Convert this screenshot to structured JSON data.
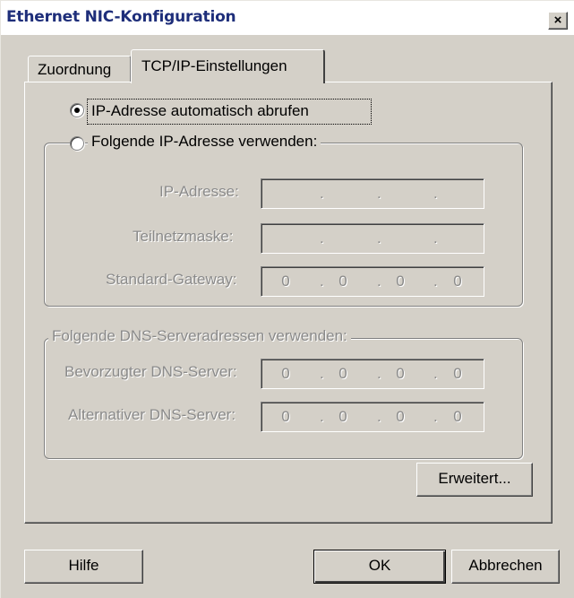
{
  "window": {
    "title": "Ethernet NIC-Konfiguration",
    "close_label": "×"
  },
  "tabs": [
    {
      "label": "Zuordnung"
    },
    {
      "label": "TCP/IP-Einstellungen"
    }
  ],
  "ip_mode": {
    "auto_label": "IP-Adresse automatisch abrufen",
    "manual_label": "Folgende IP-Adresse verwenden:",
    "selected": "auto"
  },
  "ip_group": {
    "fields": [
      {
        "label": "IP-Adresse:",
        "octets": [
          "",
          "",
          "",
          ""
        ]
      },
      {
        "label": "Teilnetzmaske:",
        "octets": [
          "",
          "",
          "",
          ""
        ]
      },
      {
        "label": "Standard-Gateway:",
        "octets": [
          "0",
          "0",
          "0",
          "0"
        ]
      }
    ]
  },
  "dns_group": {
    "caption": "Folgende DNS-Serveradressen verwenden:",
    "fields": [
      {
        "label": "Bevorzugter DNS-Server:",
        "octets": [
          "0",
          "0",
          "0",
          "0"
        ]
      },
      {
        "label": "Alternativer DNS-Server:",
        "octets": [
          "0",
          "0",
          "0",
          "0"
        ]
      }
    ]
  },
  "advanced_button": "Erweitert...",
  "footer": {
    "help": "Hilfe",
    "ok": "OK",
    "cancel": "Abbrechen"
  }
}
